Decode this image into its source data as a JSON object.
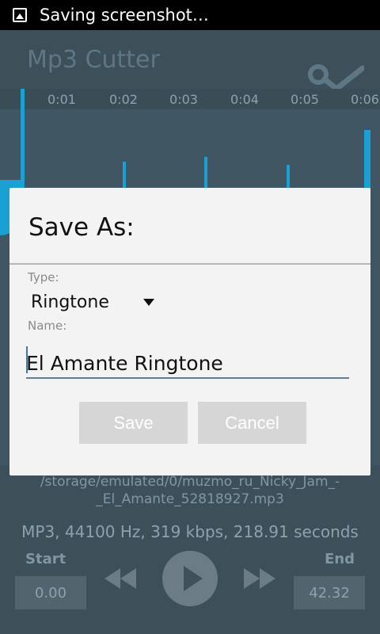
{
  "status_bar": {
    "notification_text": "Saving screenshot…",
    "notification_icon": "image-icon"
  },
  "app_bar": {
    "title": "Mp3 Cutter",
    "action_icon": "scissors-icon"
  },
  "waveform": {
    "time_ticks": [
      "0:01",
      "0:02",
      "0:03",
      "0:04",
      "0:05",
      "0:06"
    ],
    "accent_color": "#1aa0d2"
  },
  "file": {
    "path_line1": "/storage/emulated/0/muzmo_ru_Nicky_Jam_-",
    "path_line2": "_El_Amante_52818927.mp3",
    "info": "MP3, 44100 Hz, 319 kbps, 218.91 seconds"
  },
  "controls": {
    "start_label": "Start",
    "start_value": "0.00",
    "end_label": "End",
    "end_value": "42.32"
  },
  "dialog": {
    "title": "Save As:",
    "type_label": "Type:",
    "type_value": "Ringtone",
    "name_label": "Name:",
    "name_value": "El Amante Ringtone",
    "save_label": "Save",
    "cancel_label": "Cancel"
  }
}
